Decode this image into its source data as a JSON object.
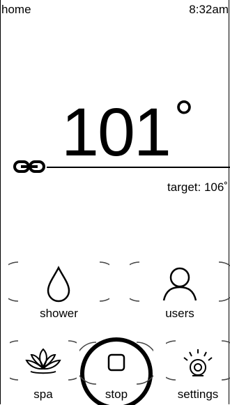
{
  "header": {
    "title": "home",
    "time": "8:32am"
  },
  "temperature": {
    "current": "101",
    "degree_symbol": "°",
    "target_label": "target: 106˚"
  },
  "controls": [
    {
      "label": "shower",
      "icon": "droplet-icon"
    },
    {
      "label": "users",
      "icon": "user-icon"
    },
    {
      "label": "spa",
      "icon": "lotus-icon"
    },
    {
      "label": "stop",
      "icon": "stop-square-icon"
    },
    {
      "label": "settings",
      "icon": "light-bulb-icon"
    }
  ]
}
